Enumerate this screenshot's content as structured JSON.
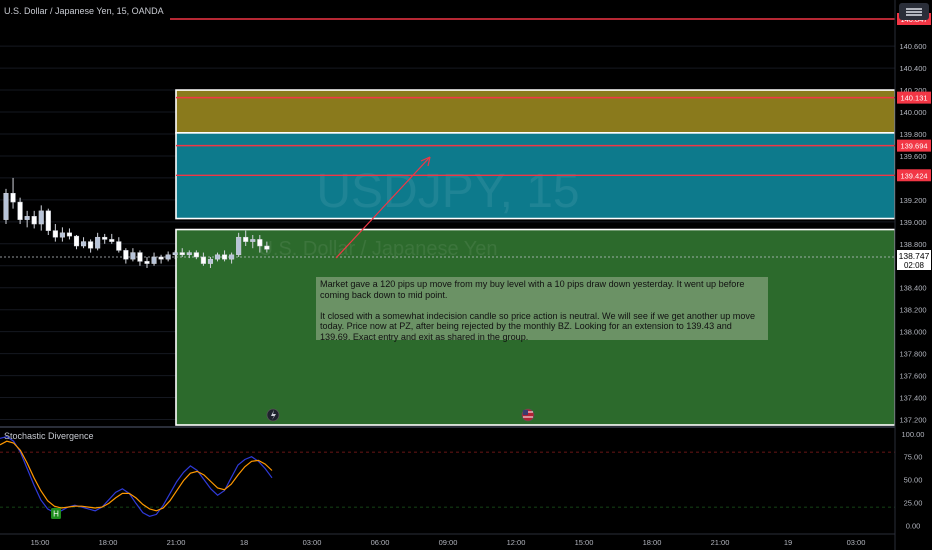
{
  "chart_title": "U.S. Dollar / Japanese Yen, 15, OANDA",
  "watermark_symbol": "USDJPY, 15",
  "watermark_name": "U.S. Dollar / Japanese Yen",
  "note": {
    "para1": "Market gave a 120 pips up move from my buy level with a 10 pips draw down yesterday. It went up before coming back down to mid point.",
    "para2": "It closed with a somewhat indecision candle so price action is neutral. We will see if we get another up move today. Price now at PZ, after being rejected by the monthly BZ. Looking for an extension to 139.43 and 139.69. Exact entry and exit as shared in the group."
  },
  "oscillator_title": "Stochastic Divergence",
  "oscillator_marker": "H",
  "current_price": "138.747",
  "countdown": "02:08",
  "colors": {
    "bull": "#d1d4dc",
    "bear": "#ffffff",
    "level": "#f23645",
    "osc_fast": "#2f3ad8",
    "osc_slow": "#ff9800",
    "zone_upper": "#8a7a1c",
    "zone_middle": "#0d7a8c",
    "zone_lower": "#2c6a2c"
  },
  "chart_data": {
    "type": "candlestick",
    "title": "U.S. Dollar / Japanese Yen, 15, OANDA",
    "x_tick_labels": [
      "15:00",
      "18:00",
      "21:00",
      "18",
      "03:00",
      "06:00",
      "09:00",
      "12:00",
      "15:00",
      "18:00",
      "21:00",
      "19",
      "03:00"
    ],
    "y_tick_labels": [
      "140.600",
      "140.400",
      "140.200",
      "140.000",
      "139.800",
      "139.600",
      "139.400",
      "139.200",
      "139.000",
      "138.800",
      "138.600",
      "138.400",
      "138.200",
      "138.000",
      "137.800",
      "137.600",
      "137.400",
      "137.200"
    ],
    "ylim": [
      137.15,
      141.02
    ],
    "price_levels": [
      140.847,
      140.131,
      139.694,
      139.424
    ],
    "zones": [
      {
        "name": "upper",
        "low": 139.81,
        "high": 140.2
      },
      {
        "name": "middle",
        "low": 139.03,
        "high": 139.81
      },
      {
        "name": "lower",
        "low": 137.15,
        "high": 138.93
      }
    ],
    "candles": [
      [
        139.02,
        139.3,
        138.98,
        139.26
      ],
      [
        139.26,
        139.4,
        139.12,
        139.18
      ],
      [
        139.18,
        139.22,
        138.98,
        139.02
      ],
      [
        139.02,
        139.1,
        138.95,
        139.05
      ],
      [
        139.05,
        139.1,
        138.94,
        138.98
      ],
      [
        138.98,
        139.15,
        138.92,
        139.1
      ],
      [
        139.1,
        139.12,
        138.88,
        138.92
      ],
      [
        138.92,
        138.98,
        138.82,
        138.86
      ],
      [
        138.86,
        138.95,
        138.82,
        138.9
      ],
      [
        138.9,
        138.94,
        138.84,
        138.87
      ],
      [
        138.87,
        138.88,
        138.75,
        138.78
      ],
      [
        138.78,
        138.86,
        138.76,
        138.82
      ],
      [
        138.82,
        138.84,
        138.72,
        138.76
      ],
      [
        138.76,
        138.9,
        138.74,
        138.86
      ],
      [
        138.86,
        138.89,
        138.8,
        138.84
      ],
      [
        138.84,
        138.89,
        138.8,
        138.82
      ],
      [
        138.82,
        138.86,
        138.72,
        138.74
      ],
      [
        138.74,
        138.76,
        138.62,
        138.66
      ],
      [
        138.66,
        138.76,
        138.64,
        138.72
      ],
      [
        138.72,
        138.74,
        138.6,
        138.64
      ],
      [
        138.64,
        138.68,
        138.58,
        138.62
      ],
      [
        138.62,
        138.72,
        138.6,
        138.68
      ],
      [
        138.68,
        138.7,
        138.62,
        138.66
      ],
      [
        138.66,
        138.73,
        138.64,
        138.7
      ],
      [
        138.7,
        138.74,
        138.66,
        138.72
      ],
      [
        138.72,
        138.76,
        138.68,
        138.7
      ],
      [
        138.7,
        138.74,
        138.67,
        138.72
      ],
      [
        138.72,
        138.74,
        138.66,
        138.68
      ],
      [
        138.68,
        138.72,
        138.6,
        138.62
      ],
      [
        138.62,
        138.68,
        138.58,
        138.66
      ],
      [
        138.66,
        138.72,
        138.64,
        138.7
      ],
      [
        138.7,
        138.74,
        138.64,
        138.66
      ],
      [
        138.66,
        138.72,
        138.62,
        138.7
      ],
      [
        138.7,
        138.9,
        138.68,
        138.86
      ],
      [
        138.86,
        138.92,
        138.78,
        138.82
      ],
      [
        138.82,
        138.88,
        138.76,
        138.84
      ],
      [
        138.84,
        138.88,
        138.72,
        138.78
      ],
      [
        138.78,
        138.82,
        138.72,
        138.75
      ]
    ],
    "oscillator": {
      "y_tick_labels": [
        "100.00",
        "75.00",
        "50.00",
        "25.00",
        "0.00"
      ],
      "ylim": [
        -5,
        102
      ],
      "fast": [
        95,
        97,
        92,
        80,
        62,
        44,
        28,
        18,
        14,
        16,
        20,
        22,
        20,
        18,
        16,
        20,
        28,
        36,
        40,
        35,
        24,
        14,
        10,
        12,
        22,
        35,
        48,
        58,
        65,
        60,
        50,
        40,
        33,
        38,
        52,
        66,
        72,
        75,
        70,
        62,
        52
      ],
      "slow": [
        88,
        92,
        90,
        82,
        68,
        52,
        38,
        27,
        21,
        19,
        20,
        21,
        21,
        20,
        19,
        20,
        24,
        30,
        35,
        35,
        30,
        23,
        18,
        16,
        19,
        27,
        38,
        49,
        57,
        59,
        55,
        48,
        41,
        39,
        45,
        55,
        64,
        70,
        71,
        67,
        60
      ]
    }
  }
}
